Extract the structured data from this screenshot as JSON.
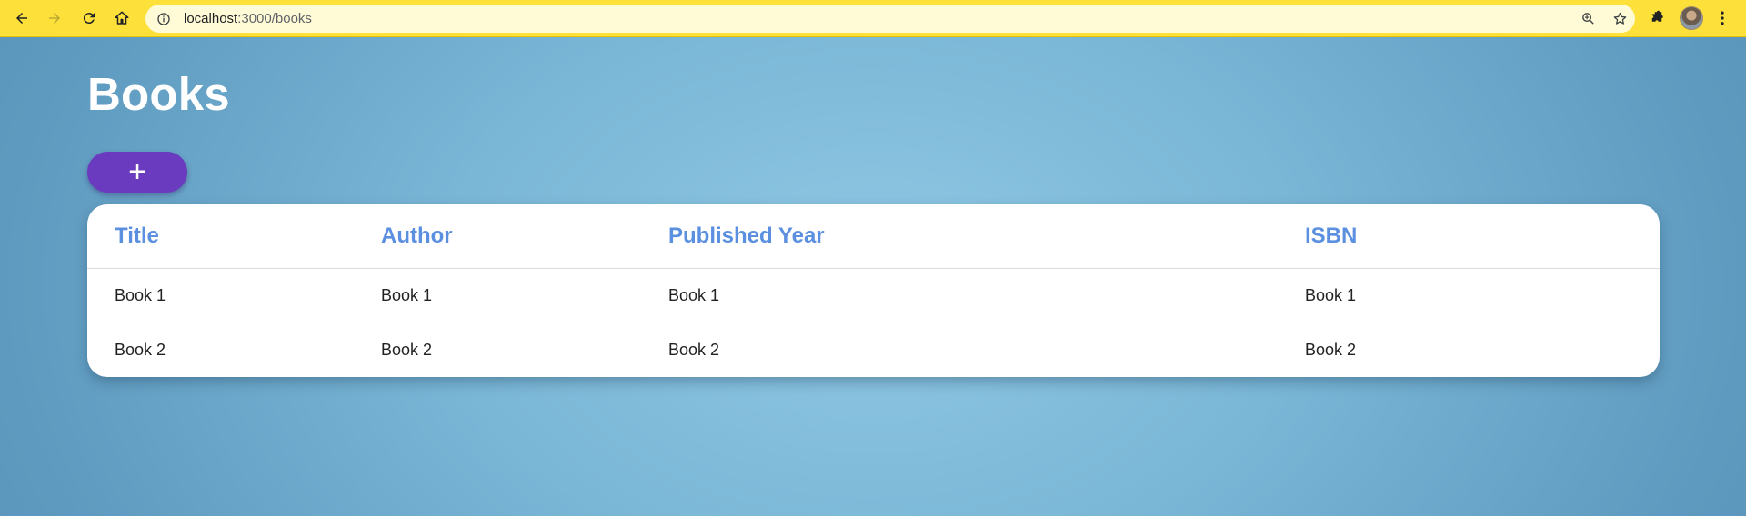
{
  "browser": {
    "url_host": "localhost",
    "url_path": ":3000/books",
    "icons": [
      "back-icon",
      "forward-icon",
      "reload-icon",
      "home-icon",
      "info-icon",
      "zoom-icon",
      "star-icon",
      "extensions-icon",
      "profile-avatar",
      "more-menu-icon"
    ],
    "theme_color": "#fde03a"
  },
  "page": {
    "title": "Books",
    "add_button_label": "+",
    "accent_color": "#6a3bbe",
    "header_color": "#5b8fe0"
  },
  "table": {
    "columns": [
      "Title",
      "Author",
      "Published Year",
      "ISBN"
    ],
    "rows": [
      [
        "Book 1",
        "Book 1",
        "Book 1",
        "Book 1"
      ],
      [
        "Book 2",
        "Book 2",
        "Book 2",
        "Book 2"
      ]
    ]
  }
}
